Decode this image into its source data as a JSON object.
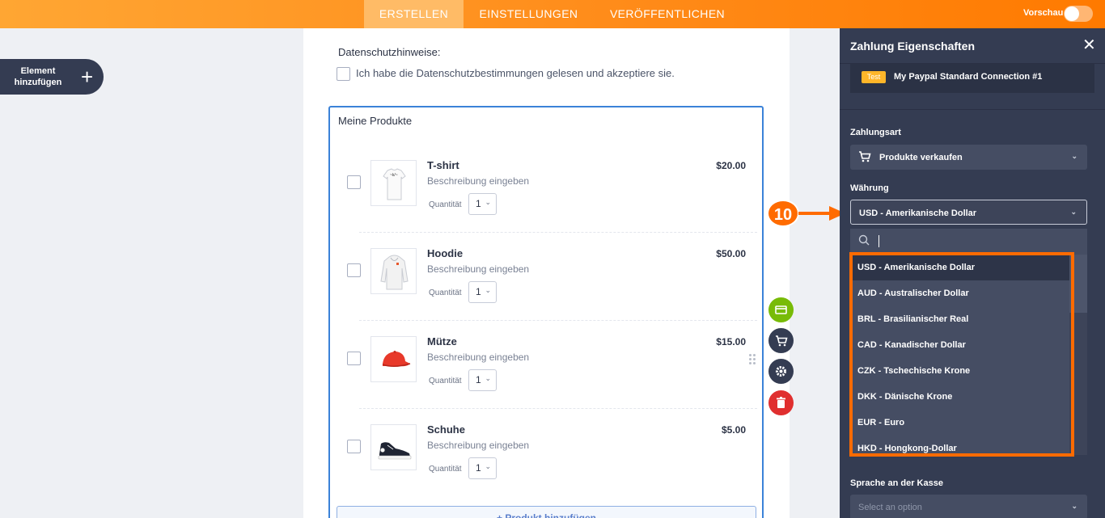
{
  "topbar": {
    "tabs": [
      {
        "label": "ERSTELLEN"
      },
      {
        "label": "EINSTELLUNGEN"
      },
      {
        "label": "VERÖFFENTLICHEN"
      }
    ],
    "preview_label": "Vorschau"
  },
  "left": {
    "add_element_label": "Element hinzufügen"
  },
  "form": {
    "privacy_title": "Datenschutzhinweise:",
    "privacy_text": "Ich habe die Datenschutzbestimmungen gelesen und akzeptiere sie.",
    "products_title": "Meine Produkte",
    "quantity_label": "Quantität",
    "products": [
      {
        "name": "T-shirt",
        "description": "Beschreibung eingeben",
        "price": "$20.00",
        "quantity": "1",
        "icon": "tshirt-icon"
      },
      {
        "name": "Hoodie",
        "description": "Beschreibung eingeben",
        "price": "$50.00",
        "quantity": "1",
        "icon": "hoodie-icon"
      },
      {
        "name": "Mütze",
        "description": "Beschreibung eingeben",
        "price": "$15.00",
        "quantity": "1",
        "icon": "cap-icon"
      },
      {
        "name": "Schuhe",
        "description": "Beschreibung eingeben",
        "price": "$5.00",
        "quantity": "1",
        "icon": "sneaker-icon"
      }
    ],
    "add_product_label": "+ Produkt hinzufügen"
  },
  "callout": {
    "number": "10"
  },
  "panel": {
    "title": "Zahlung Eigenschaften",
    "connection_badge": "Test",
    "connection_name": "My Paypal Standard Connection #1",
    "payment_type_label": "Zahlungsart",
    "payment_type_value": "Produkte verkaufen",
    "currency_label": "Währung",
    "currency_value": "USD - Amerikanische Dollar",
    "currency_options": [
      "USD - Amerikanische Dollar",
      "AUD - Australischer Dollar",
      "BRL - Brasilianischer Real",
      "CAD - Kanadischer Dollar",
      "CZK - Tschechische Krone",
      "DKK - Dänische Krone",
      "EUR - Euro",
      "HKD - Hongkong-Dollar"
    ],
    "checkout_language_label": "Sprache an der Kasse",
    "checkout_language_placeholder": "Select an option"
  },
  "colors": {
    "accent_orange": "#ff6b00",
    "panel_bg": "#343c52",
    "form_border": "#3b82d8",
    "badge": "#ffb629"
  }
}
